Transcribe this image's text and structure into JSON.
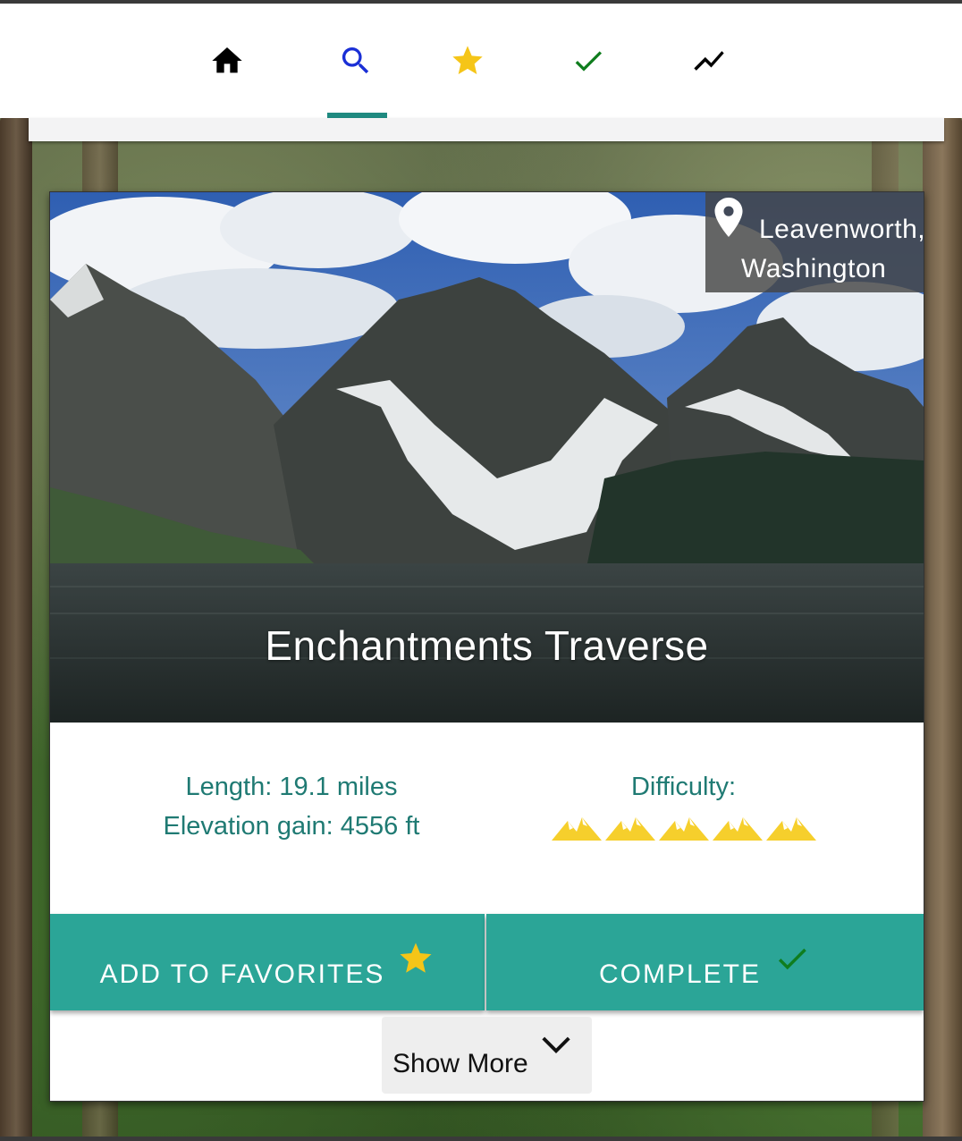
{
  "nav": {
    "items": [
      {
        "name": "home",
        "icon": "home-icon",
        "color": "#000000"
      },
      {
        "name": "search",
        "icon": "search-icon",
        "color": "#1a2fd6",
        "active": true
      },
      {
        "name": "favorites",
        "icon": "star-icon",
        "color": "#f5c518"
      },
      {
        "name": "completed",
        "icon": "check-icon",
        "color": "#0f7d1e"
      },
      {
        "name": "stats",
        "icon": "trend-icon",
        "color": "#000000"
      }
    ],
    "indicator_color": "#1f8a80"
  },
  "trail": {
    "title": "Enchantments Traverse",
    "location": {
      "icon": "location-pin-icon",
      "line1": "Leavenworth,",
      "line2": "Washington"
    },
    "length_text": "Length: 19.1 miles",
    "elevation_text": "Elevation gain: 4556 ft",
    "difficulty_label": "Difficulty:",
    "difficulty_rating": 5,
    "difficulty_max": 5,
    "difficulty_color": "#f6cf2c"
  },
  "actions": {
    "favorites_label": "ADD TO FAVORITES",
    "favorites_icon": "star-icon",
    "complete_label": "COMPLETE",
    "complete_icon": "check-icon",
    "button_color": "#2ba597",
    "show_more_label": "Show More",
    "show_more_icon": "chevron-down-icon"
  },
  "colors": {
    "accent_text": "#1f7a73",
    "star": "#f5c518",
    "check": "#0f7d1e"
  }
}
